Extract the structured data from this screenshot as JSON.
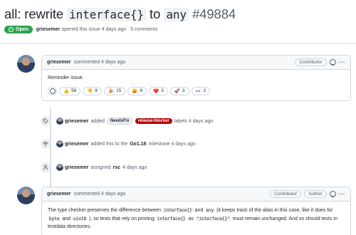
{
  "title": {
    "prefix": "all: rewrite ",
    "code1": "interface{}",
    "mid": " to ",
    "code2": "any",
    "number": "#49884"
  },
  "meta": {
    "state": "Open",
    "author": "griesemer",
    "text": "opened this issue 4 days ago · 5 comments"
  },
  "comment1": {
    "author": "griesemer",
    "time": "commented 4 days ago",
    "role": "Contributor",
    "body": "Reminder issue.",
    "reactions": [
      {
        "emoji": "👍",
        "count": "56"
      },
      {
        "emoji": "👎",
        "count": "8"
      },
      {
        "emoji": "🎉",
        "count": "15"
      },
      {
        "emoji": "😄",
        "count": "6"
      },
      {
        "emoji": "❤️",
        "count": "3"
      },
      {
        "emoji": "🚀",
        "count": "3"
      },
      {
        "emoji": "👀",
        "count": "2"
      }
    ]
  },
  "events": {
    "labels": {
      "actor": "griesemer",
      "verb": "added",
      "label1": "NeedsFix",
      "label2": "release-blocker",
      "suffix": "labels 4 days ago"
    },
    "milestone": {
      "actor": "griesemer",
      "verb": "added this to the",
      "milestone": "Go1.18",
      "suffix": "milestone 4 days ago"
    },
    "assign": {
      "actor": "griesemer",
      "verb": "assigned",
      "assignee": "rsc",
      "suffix": "4 days ago"
    }
  },
  "comment2": {
    "author": "griesemer",
    "time": "commented 4 days ago",
    "role1": "Contributor",
    "role2": "Author",
    "p1": "The type checker preserves the difference between ",
    "c1": "interface{}",
    "p2": " and ",
    "c2": "any",
    "p3": " (it keeps track of the alias in this case, like it does for ",
    "c3": "byte",
    "p4": " and ",
    "c4": "uint8",
    "p5": " ), so tests that rely on printing ",
    "c5": "interface{}",
    "p6": " as ",
    "c6": "\"interface{}\"",
    "p7": " must remain unchanged. And so should tests in testdata directories."
  },
  "colors": {
    "open_green": "#2da44e",
    "release_blocker": "#b60205",
    "border": "#d0d7de"
  }
}
